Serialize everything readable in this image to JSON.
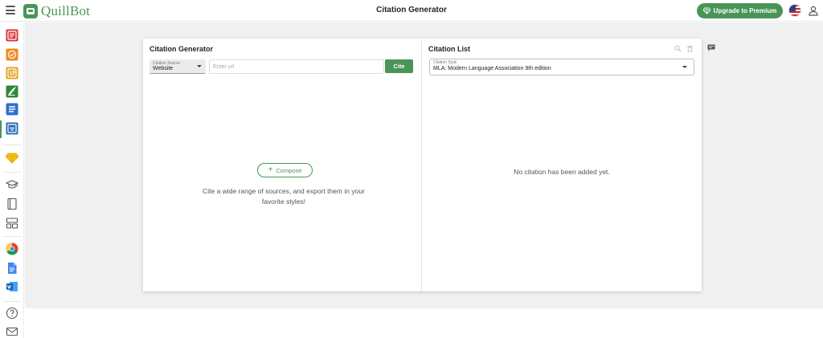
{
  "app": {
    "name": "QuillBot",
    "page_title": "Citation Generator",
    "brand_color": "#499557"
  },
  "header": {
    "upgrade_label": "Upgrade to Premium"
  },
  "sidebar": {
    "items": [
      {
        "name": "paraphraser-icon",
        "color": "#d9343a"
      },
      {
        "name": "grammar-checker-icon",
        "color": "#f08a1c"
      },
      {
        "name": "plagiarism-checker-icon",
        "color": "#e0a21a"
      },
      {
        "name": "co-writer-icon",
        "color": "#2f8a3a"
      },
      {
        "name": "summarizer-icon",
        "color": "#2f6fcc"
      },
      {
        "name": "citation-generator-icon",
        "color": "#2a6db5"
      }
    ],
    "premium_icon": "diamond-icon",
    "more_tools": [
      "graduation-cap-icon",
      "notebook-icon",
      "layout-icon"
    ],
    "extensions": [
      "chrome-icon",
      "google-docs-icon",
      "word-icon"
    ],
    "footer": [
      "help-icon",
      "mail-icon"
    ]
  },
  "generator": {
    "title": "Citation Generator",
    "source_label": "Citation Source",
    "source_value": "Website",
    "url_placeholder": "Enter url",
    "cite_label": "Cite",
    "compose_label": "Compose",
    "empty_message": "Cite a wide range of sources, and export them in your favorite styles!"
  },
  "citation_list": {
    "title": "Citation List",
    "style_label": "Citation Style",
    "style_value": "MLA: Modern Language Association 9th edition",
    "empty_message": "No citation has been added yet."
  }
}
